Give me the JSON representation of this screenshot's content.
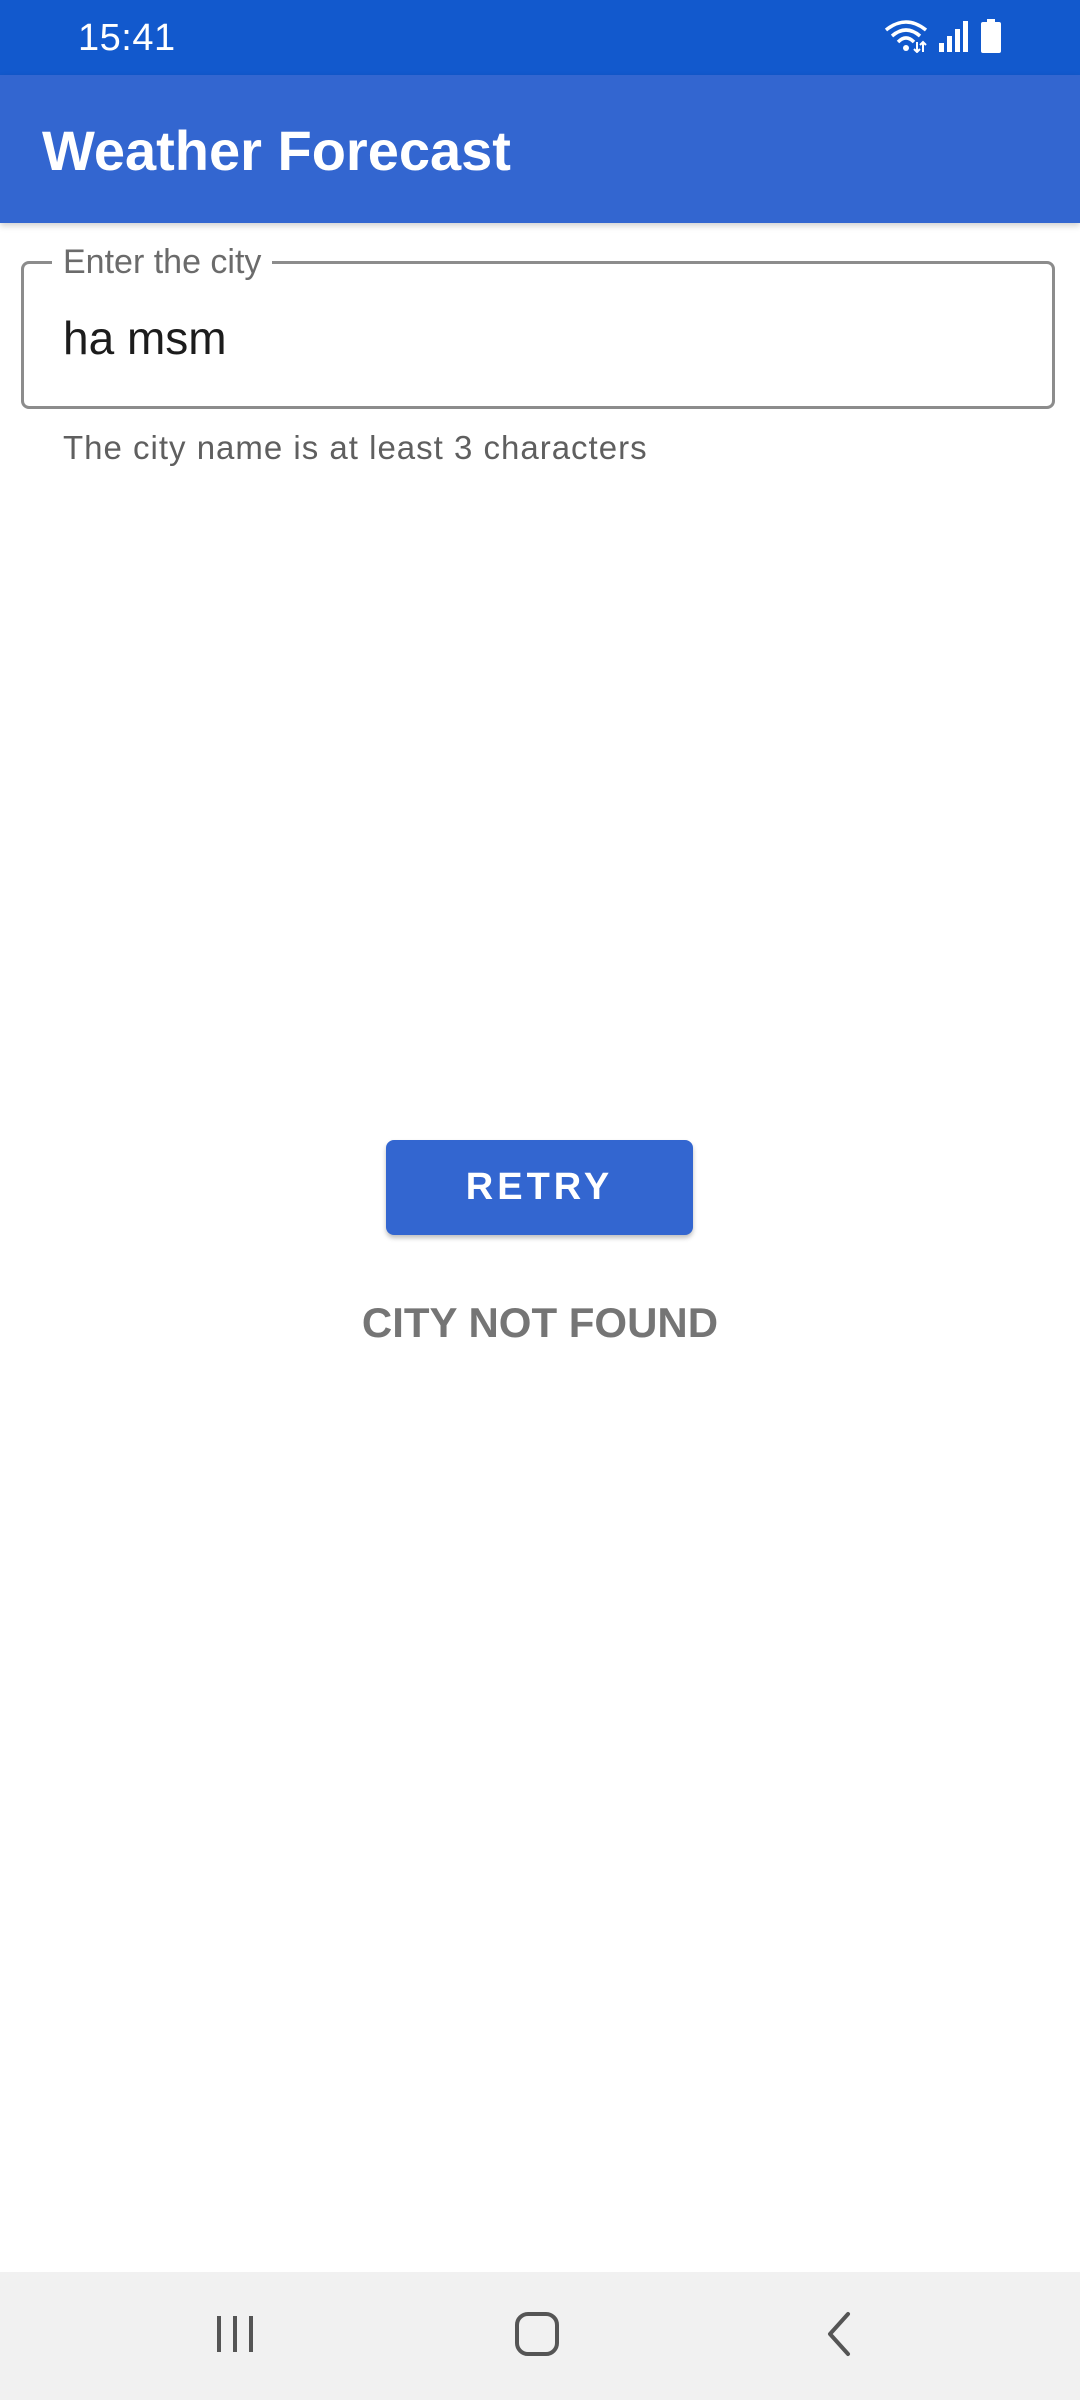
{
  "status_bar": {
    "time": "15:41",
    "icons": [
      "wifi-icon",
      "cell-signal-icon",
      "battery-icon"
    ]
  },
  "app_bar": {
    "title": "Weather Forecast"
  },
  "city_field": {
    "label": "Enter the city",
    "value": "ha msm",
    "helper": "The city name is at least 3 characters"
  },
  "retry_button": {
    "label": "RETRY"
  },
  "error": {
    "message": "CITY NOT FOUND"
  },
  "nav_bar": {
    "buttons": [
      "recent-apps-icon",
      "home-icon",
      "back-icon"
    ]
  },
  "colors": {
    "status_bar": "#1259CD",
    "primary": "#3366D0",
    "error_text": "#757575"
  }
}
